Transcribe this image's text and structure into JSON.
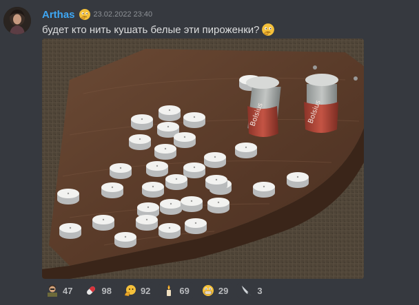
{
  "message": {
    "username": "Arthas",
    "timestamp": "23.02.2022 23:40",
    "text": "будет кто нить кушать белые эти пироженки?",
    "username_color": "#3ea7f4"
  },
  "attachment": {
    "candle_label": "Bolsius"
  },
  "reactions": [
    {
      "icon": "person-emote-icon",
      "count": "47"
    },
    {
      "icon": "pill-icon",
      "count": "98"
    },
    {
      "icon": "thinking-hand-emote-icon",
      "count": "92"
    },
    {
      "icon": "candle-icon",
      "count": "69"
    },
    {
      "icon": "grimace-emote-icon",
      "count": "29"
    },
    {
      "icon": "knife-icon",
      "count": "3"
    }
  ]
}
